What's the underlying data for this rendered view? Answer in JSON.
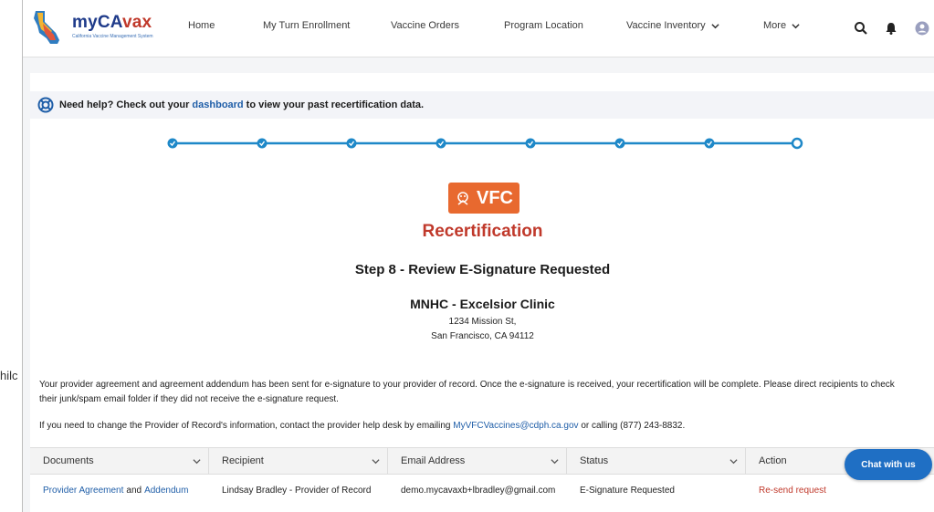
{
  "outside_fragment": "hilc",
  "app": {
    "logo_title_a": "myCA",
    "logo_title_b": "vax",
    "logo_subtitle": "California Vaccine Management System"
  },
  "nav": {
    "home": "Home",
    "my_turn": "My Turn Enrollment",
    "vaccine_orders": "Vaccine Orders",
    "program_location": "Program Location",
    "vaccine_inventory": "Vaccine Inventory",
    "more": "More"
  },
  "toolbar_icons": [
    "search-icon",
    "bell-icon",
    "user-avatar-icon"
  ],
  "help": {
    "prefix": "Need help? Check out your",
    "link": "dashboard",
    "suffix": "to view your past recertification data."
  },
  "stepper": {
    "total_steps": 8,
    "completed_steps": 7,
    "current_step": 8,
    "color": "#1e88c8"
  },
  "brand": {
    "vfc_label": "VFC",
    "vfc_color": "#e8692f",
    "recert_title": "Recertification",
    "accent": "#c0392b"
  },
  "step_title": "Step 8 - Review E-Signature Requested",
  "clinic": {
    "name": "MNHC - Excelsior Clinic",
    "address1": "1234 Mission St,",
    "address2": "San Francisco, CA 94112"
  },
  "message": {
    "line1": "Your provider agreement and agreement addendum has been sent for e-signature to your provider of record. Once the e-signature is received, your recertification will be complete. Please direct recipients to check",
    "line2": "their junk/spam email folder if they did not receive the e-signature request."
  },
  "contact": {
    "prefix": "If you need to change the Provider of Record's information, contact the provider help desk by emailing",
    "email": "MyVFCVaccines@cdph.ca.gov",
    "suffix": "or calling (877) 243-8832."
  },
  "table": {
    "headers": [
      "Documents",
      "Recipient",
      "Email Address",
      "Status",
      "Action"
    ],
    "row": {
      "doc_link1": "Provider Agreement",
      "doc_and": "and",
      "doc_link2": "Addendum",
      "recipient": "Lindsay Bradley - Provider of Record",
      "email": "demo.mycavaxb+lbradley@gmail.com",
      "status": "E-Signature Requested",
      "action": "Re-send request"
    }
  },
  "chat": {
    "label": "Chat with us"
  }
}
